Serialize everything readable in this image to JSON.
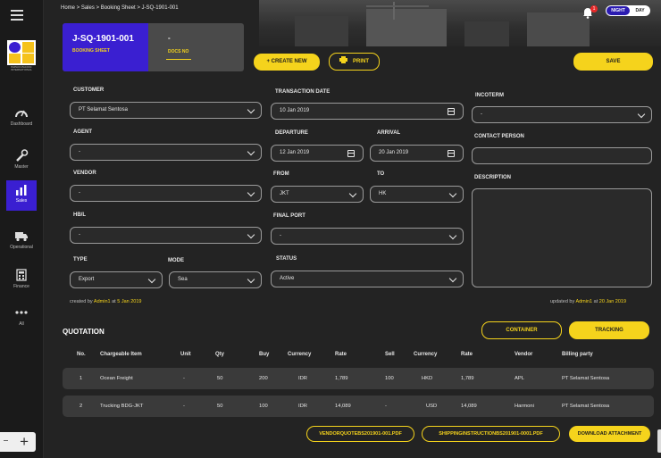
{
  "breadcrumb": "Home > Sales > Booking Sheet > J-SQ-1901-001",
  "theme_toggle": {
    "night": "NIGHT",
    "day": "DAY"
  },
  "notifications": {
    "count": "1"
  },
  "logo": {
    "caption": "PAPAYA PACIFIC INTERNATIONAL"
  },
  "sidebar": {
    "items": [
      {
        "label": "Dashboard",
        "icon": "gauge-icon"
      },
      {
        "label": "Master",
        "icon": "wrench-icon"
      },
      {
        "label": "Sales",
        "icon": "chart-icon"
      },
      {
        "label": "Operational",
        "icon": "truck-icon"
      },
      {
        "label": "Finance",
        "icon": "calculator-icon"
      },
      {
        "label": "All",
        "icon": "more-icon"
      }
    ],
    "bottom_button": "+"
  },
  "doc": {
    "number": "J-SQ-1901-001",
    "type": "BOOKING SHEET",
    "docs_value": "-",
    "docs_label": "DOCS NO"
  },
  "actions": {
    "create_new": "+ CREATE NEW",
    "print": "PRINT",
    "save": "SAVE"
  },
  "form": {
    "customer": {
      "label": "CUSTOMER",
      "value": "PT Selamat Sentosa"
    },
    "agent": {
      "label": "AGENT",
      "value": "-"
    },
    "vendor": {
      "label": "VENDOR",
      "value": "-"
    },
    "hbl": {
      "label": "HB/L",
      "value": "-"
    },
    "type": {
      "label": "TYPE",
      "value": "Export"
    },
    "mode": {
      "label": "MODE",
      "value": "Sea"
    },
    "transaction_date": {
      "label": "TRANSACTION DATE",
      "value": "10 Jan 2019"
    },
    "departure": {
      "label": "DEPARTURE",
      "value": "12 Jan 2019"
    },
    "arrival": {
      "label": "ARRIVAL",
      "value": "20 Jan 2019"
    },
    "from": {
      "label": "FROM",
      "value": "JKT"
    },
    "to": {
      "label": "TO",
      "value": "HK"
    },
    "final_port": {
      "label": "FINAL PORT",
      "value": "-"
    },
    "status": {
      "label": "STATUS",
      "value": "Active"
    },
    "incoterm": {
      "label": "INCOTERM",
      "value": "-"
    },
    "contact_person": {
      "label": "CONTACT PERSON",
      "value": ""
    },
    "description": {
      "label": "DESCRIPTION",
      "value": ""
    }
  },
  "meta": {
    "created_prefix": "created by",
    "created_user": "Admin1",
    "created_at_word": "at",
    "created_date": "5 Jan 2019",
    "updated_prefix": "updated by",
    "updated_user": "Admin1",
    "updated_at_word": "at",
    "updated_date": "20 Jan 2019"
  },
  "quotation": {
    "title": "QUOTATION",
    "container_button": "CONTAINER",
    "tracking_button": "TRACKING",
    "columns": [
      "No.",
      "Chargeable Item",
      "Unit",
      "Qty",
      "Buy",
      "Currency",
      "Rate",
      "Sell",
      "Currency",
      "Rate",
      "Vendor",
      "Billing party"
    ],
    "rows": [
      [
        "1",
        "Ocean Freight",
        "-",
        "50",
        "200",
        "IDR",
        "1,789",
        "100",
        "HKD",
        "1,789",
        "APL",
        "PT Selamat Sentosa"
      ],
      [
        "2",
        "Trucking BDG-JKT",
        "-",
        "50",
        "100",
        "IDR",
        "14,089",
        "-",
        "USD",
        "14,089",
        "Harmoni",
        "PT Selamat Sentosa"
      ]
    ]
  },
  "documents": {
    "file1": "VENDORQUOTEBS201901-001.PDF",
    "file2": "SHIPPINGINSTRUCTIONBS201901-0001.PDF",
    "download": "DOWNLOAD ATTACHMENT"
  },
  "colors": {
    "accent": "#f5d31c",
    "brand": "#3a1fd1",
    "background": "#232323",
    "danger": "#e62929"
  }
}
